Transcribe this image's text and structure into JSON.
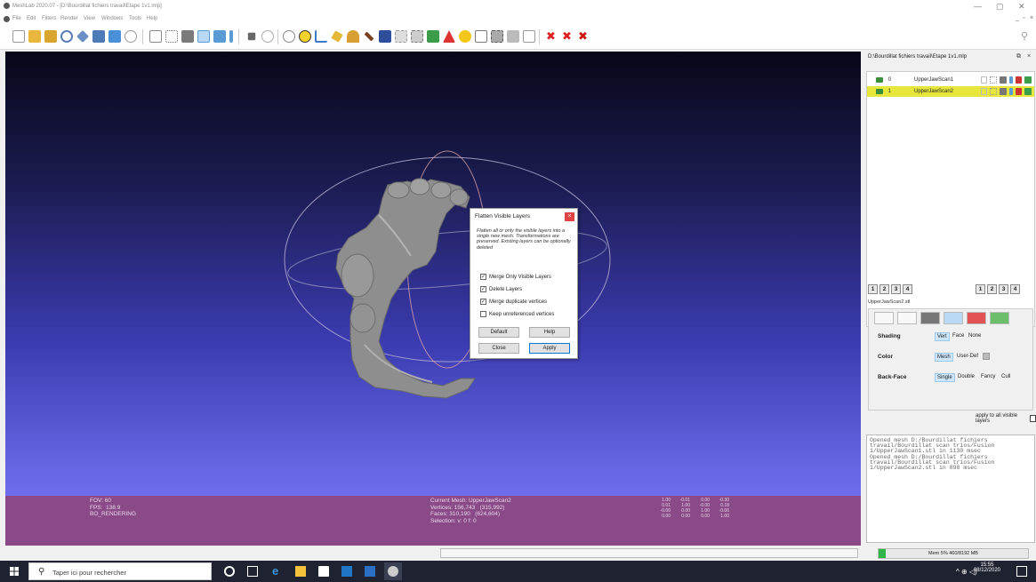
{
  "window": {
    "title": "MeshLab 2020.07 - [D:\\Bourdillat fichiers travail\\Etape 1v1.mlp]",
    "minimize": "—",
    "maximize": "▢",
    "close": "✕"
  },
  "menu": [
    "File",
    "Edit",
    "Filters",
    "Render",
    "View",
    "Windows",
    "Tools",
    "Help"
  ],
  "viewport": {
    "left_info": "FOV: 60\nFPS:  138.9\nBO_RENDERING",
    "mid_info": "Current Mesh: UpperJawScan2\nVertices: 156,743   (315,992)\nFaces: 310,190   (624,604)\nSelection: v: 0 f: 0",
    "matrix": [
      [
        "1.00",
        "-0.01",
        "0.00",
        "-0.30"
      ],
      [
        "0.01",
        "1.00",
        "-0.00",
        "0.18"
      ],
      [
        "-0.00",
        "0.00",
        "1.00",
        "-0.06"
      ],
      [
        "0.00",
        "0.00",
        "0.00",
        "1.00"
      ]
    ]
  },
  "dialog": {
    "title": "Flatten Visible Layers",
    "description": "Flatten all or only the visible layers into a single new mesh. Transformations are preserved. Existing layers can be optionally deleted",
    "options": [
      {
        "label": "Merge Only Visible Layers",
        "checked": true
      },
      {
        "label": "Delete Layers",
        "checked": true
      },
      {
        "label": "Merge duplicate vertices",
        "checked": true
      },
      {
        "label": "Keep unreferenced vertices",
        "checked": false
      }
    ],
    "buttons": {
      "default": "Default",
      "help": "Help",
      "close": "Close",
      "apply": "Apply"
    }
  },
  "panel": {
    "title": "D:\\Bourdillat fichiers travail\\Etape 1v1.mlp",
    "layers": [
      {
        "id": "0",
        "name": "UpperJawScan1",
        "selected": false
      },
      {
        "id": "1",
        "name": "UpperJawScan2",
        "selected": true
      }
    ],
    "view_buttons": [
      "1",
      "2",
      "3",
      "4"
    ],
    "mesh_file": "UpperJawScan2.stl",
    "shading": {
      "label": "Shading",
      "options": [
        "Vert",
        "Face",
        "None"
      ],
      "selected": "Vert"
    },
    "color": {
      "label": "Color",
      "options": [
        "Mesh",
        "User-Def"
      ],
      "selected": "Mesh"
    },
    "backface": {
      "label": "Back-Face",
      "options": [
        "Single",
        "Double",
        "Fancy",
        "Cull"
      ],
      "selected": "Single"
    },
    "apply_all": "apply to all visible layers",
    "log": "Opened mesh D:/Bourdillat fichiers\ntravail/Bourdillat scan trios/Fusion\n1/UpperJawScan1.stl in 1130 msec\nOpened mesh D:/Bourdillat fichiers\ntravail/Bourdillat scan trios/Fusion\n1/UpperJawScan2.stl in 898 msec",
    "memory": {
      "label": "Mem 5% 460/8192 MB",
      "fraction": 0.05
    }
  },
  "taskbar": {
    "search_placeholder": "Taper ici pour rechercher",
    "time": "15:55",
    "date": "08/12/2020"
  },
  "colors": {
    "accent": "#0078d7",
    "selected_layer": "#e6e63c",
    "info_bar": "#8a4a87",
    "mesh": "#8a8a8a"
  }
}
